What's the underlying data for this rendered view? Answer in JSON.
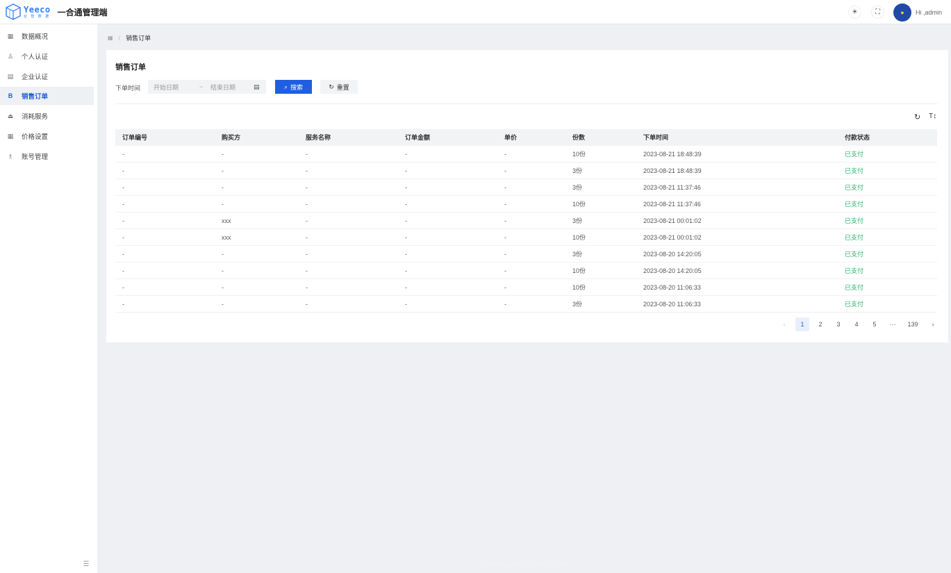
{
  "header": {
    "logo_text": "Yeeco",
    "logo_sub": "云 智 数 据",
    "app_title": "一合通管理端",
    "theme_icon": "sun-icon",
    "fullscreen_icon": "fullscreen-icon",
    "greeting": "Hi ,admin"
  },
  "sidebar": {
    "items": [
      {
        "label": "数据概况",
        "icon": "dashboard-icon"
      },
      {
        "label": "个人认证",
        "icon": "user-icon"
      },
      {
        "label": "企业认证",
        "icon": "building-icon"
      },
      {
        "label": "销售订单",
        "icon": "order-icon",
        "active": true
      },
      {
        "label": "消耗服务",
        "icon": "service-icon"
      },
      {
        "label": "价格设置",
        "icon": "price-icon"
      },
      {
        "label": "账号管理",
        "icon": "account-icon"
      }
    ],
    "collapse_icon": "menu-collapse-icon"
  },
  "breadcrumb": {
    "current": "销售订单"
  },
  "card": {
    "title": "销售订单",
    "filter": {
      "label": "下单时间",
      "start_placeholder": "开始日期",
      "separator": "~",
      "end_placeholder": "结束日期",
      "search_label": "搜索",
      "reset_label": "重置"
    }
  },
  "table": {
    "columns": [
      "订单编号",
      "购买方",
      "服务名称",
      "订单金额",
      "单价",
      "份数",
      "下单时间",
      "付款状态"
    ],
    "rows": [
      {
        "order_no": "-",
        "buyer": "-",
        "service": "-",
        "amount": "-",
        "price": "-",
        "qty": "10份",
        "time": "2023-08-21 18:48:39",
        "status": "已支付"
      },
      {
        "order_no": "-",
        "buyer": "-",
        "service": "-",
        "amount": "-",
        "price": "-",
        "qty": "3份",
        "time": "2023-08-21 18:48:39",
        "status": "已支付"
      },
      {
        "order_no": "-",
        "buyer": "-",
        "service": "-",
        "amount": "-",
        "price": "-",
        "qty": "3份",
        "time": "2023-08-21 11:37:46",
        "status": "已支付"
      },
      {
        "order_no": "-",
        "buyer": "-",
        "service": "-",
        "amount": "-",
        "price": "-",
        "qty": "10份",
        "time": "2023-08-21 11:37:46",
        "status": "已支付"
      },
      {
        "order_no": "-",
        "buyer": "xxx",
        "service": "-",
        "amount": "-",
        "price": "-",
        "qty": "3份",
        "time": "2023-08-21 00:01:02",
        "status": "已支付"
      },
      {
        "order_no": "-",
        "buyer": "xxx",
        "service": "-",
        "amount": "-",
        "price": "-",
        "qty": "10份",
        "time": "2023-08-21 00:01:02",
        "status": "已支付"
      },
      {
        "order_no": "-",
        "buyer": "-",
        "service": "-",
        "amount": "-",
        "price": "-",
        "qty": "3份",
        "time": "2023-08-20 14:20:05",
        "status": "已支付"
      },
      {
        "order_no": "-",
        "buyer": "-",
        "service": "-",
        "amount": "-",
        "price": "-",
        "qty": "10份",
        "time": "2023-08-20 14:20:05",
        "status": "已支付"
      },
      {
        "order_no": "-",
        "buyer": "-",
        "service": "-",
        "amount": "-",
        "price": "-",
        "qty": "10份",
        "time": "2023-08-20 11:06:33",
        "status": "已支付"
      },
      {
        "order_no": "-",
        "buyer": "-",
        "service": "-",
        "amount": "-",
        "price": "-",
        "qty": "3份",
        "time": "2023-08-20 11:06:33",
        "status": "已支付"
      }
    ]
  },
  "pagination": {
    "pages": [
      "1",
      "2",
      "3",
      "4",
      "5"
    ],
    "ellipsis": "···",
    "last_page": "139",
    "current": "1"
  },
  "colors": {
    "primary": "#1f5ee0",
    "paid": "#2db36f",
    "page_bg": "#eef0f3"
  },
  "footer": "云智数据科技有限公司提供技术支持"
}
